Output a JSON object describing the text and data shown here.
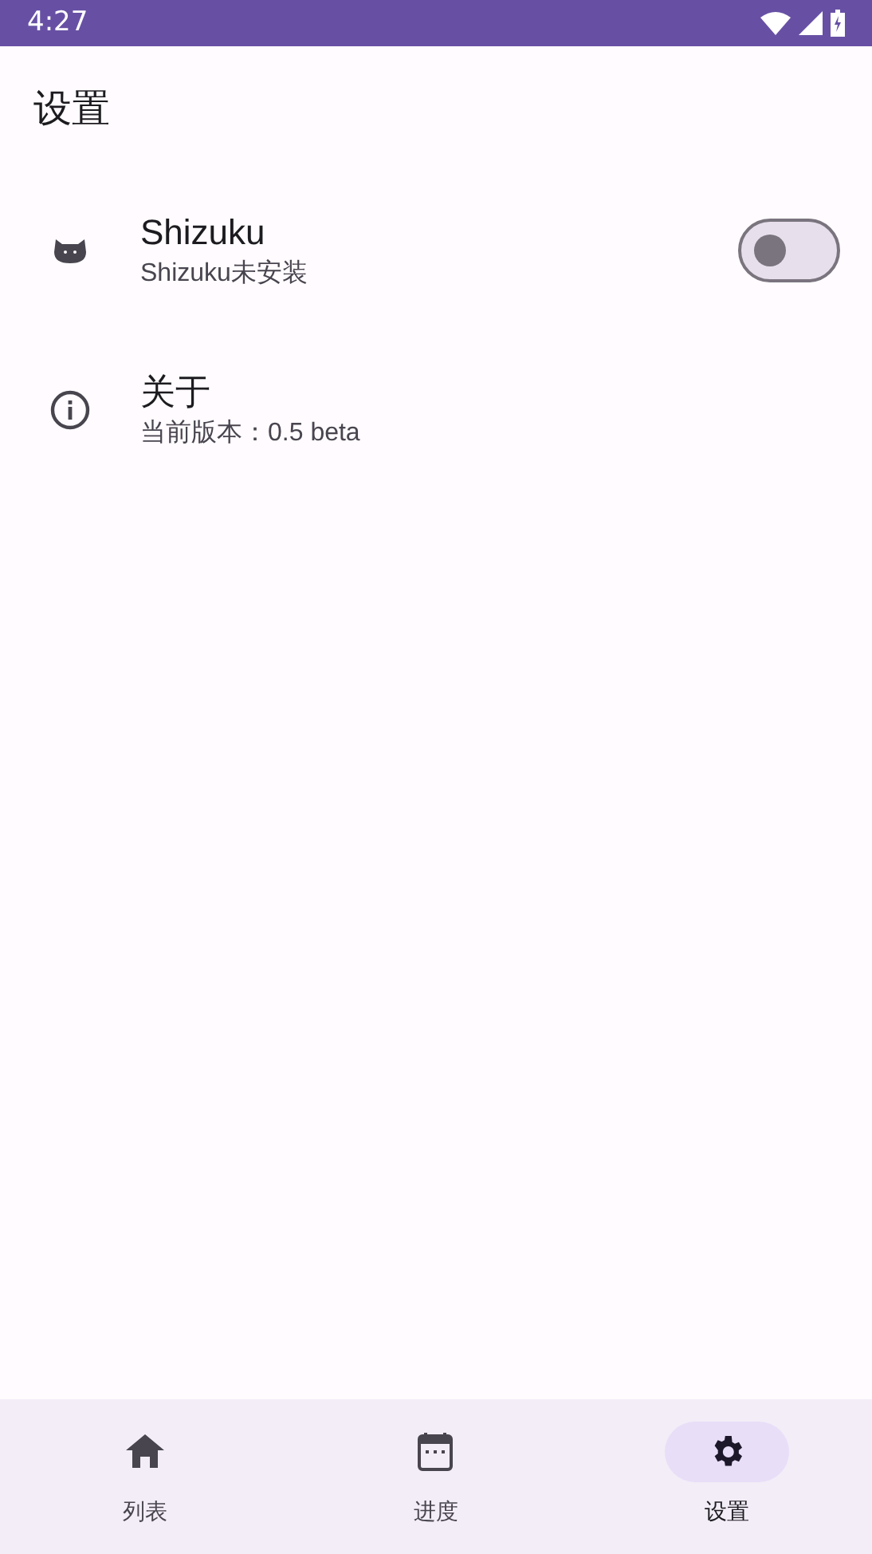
{
  "status_bar": {
    "time": "4:27"
  },
  "title": "设置",
  "settings": [
    {
      "kind": "toggle",
      "title": "Shizuku",
      "subtitle": "Shizuku未安装",
      "on": false
    },
    {
      "kind": "plain",
      "title": "关于",
      "subtitle": "当前版本：0.5 beta"
    }
  ],
  "nav": [
    {
      "label": "列表",
      "selected": false
    },
    {
      "label": "进度",
      "selected": false
    },
    {
      "label": "设置",
      "selected": true
    }
  ]
}
